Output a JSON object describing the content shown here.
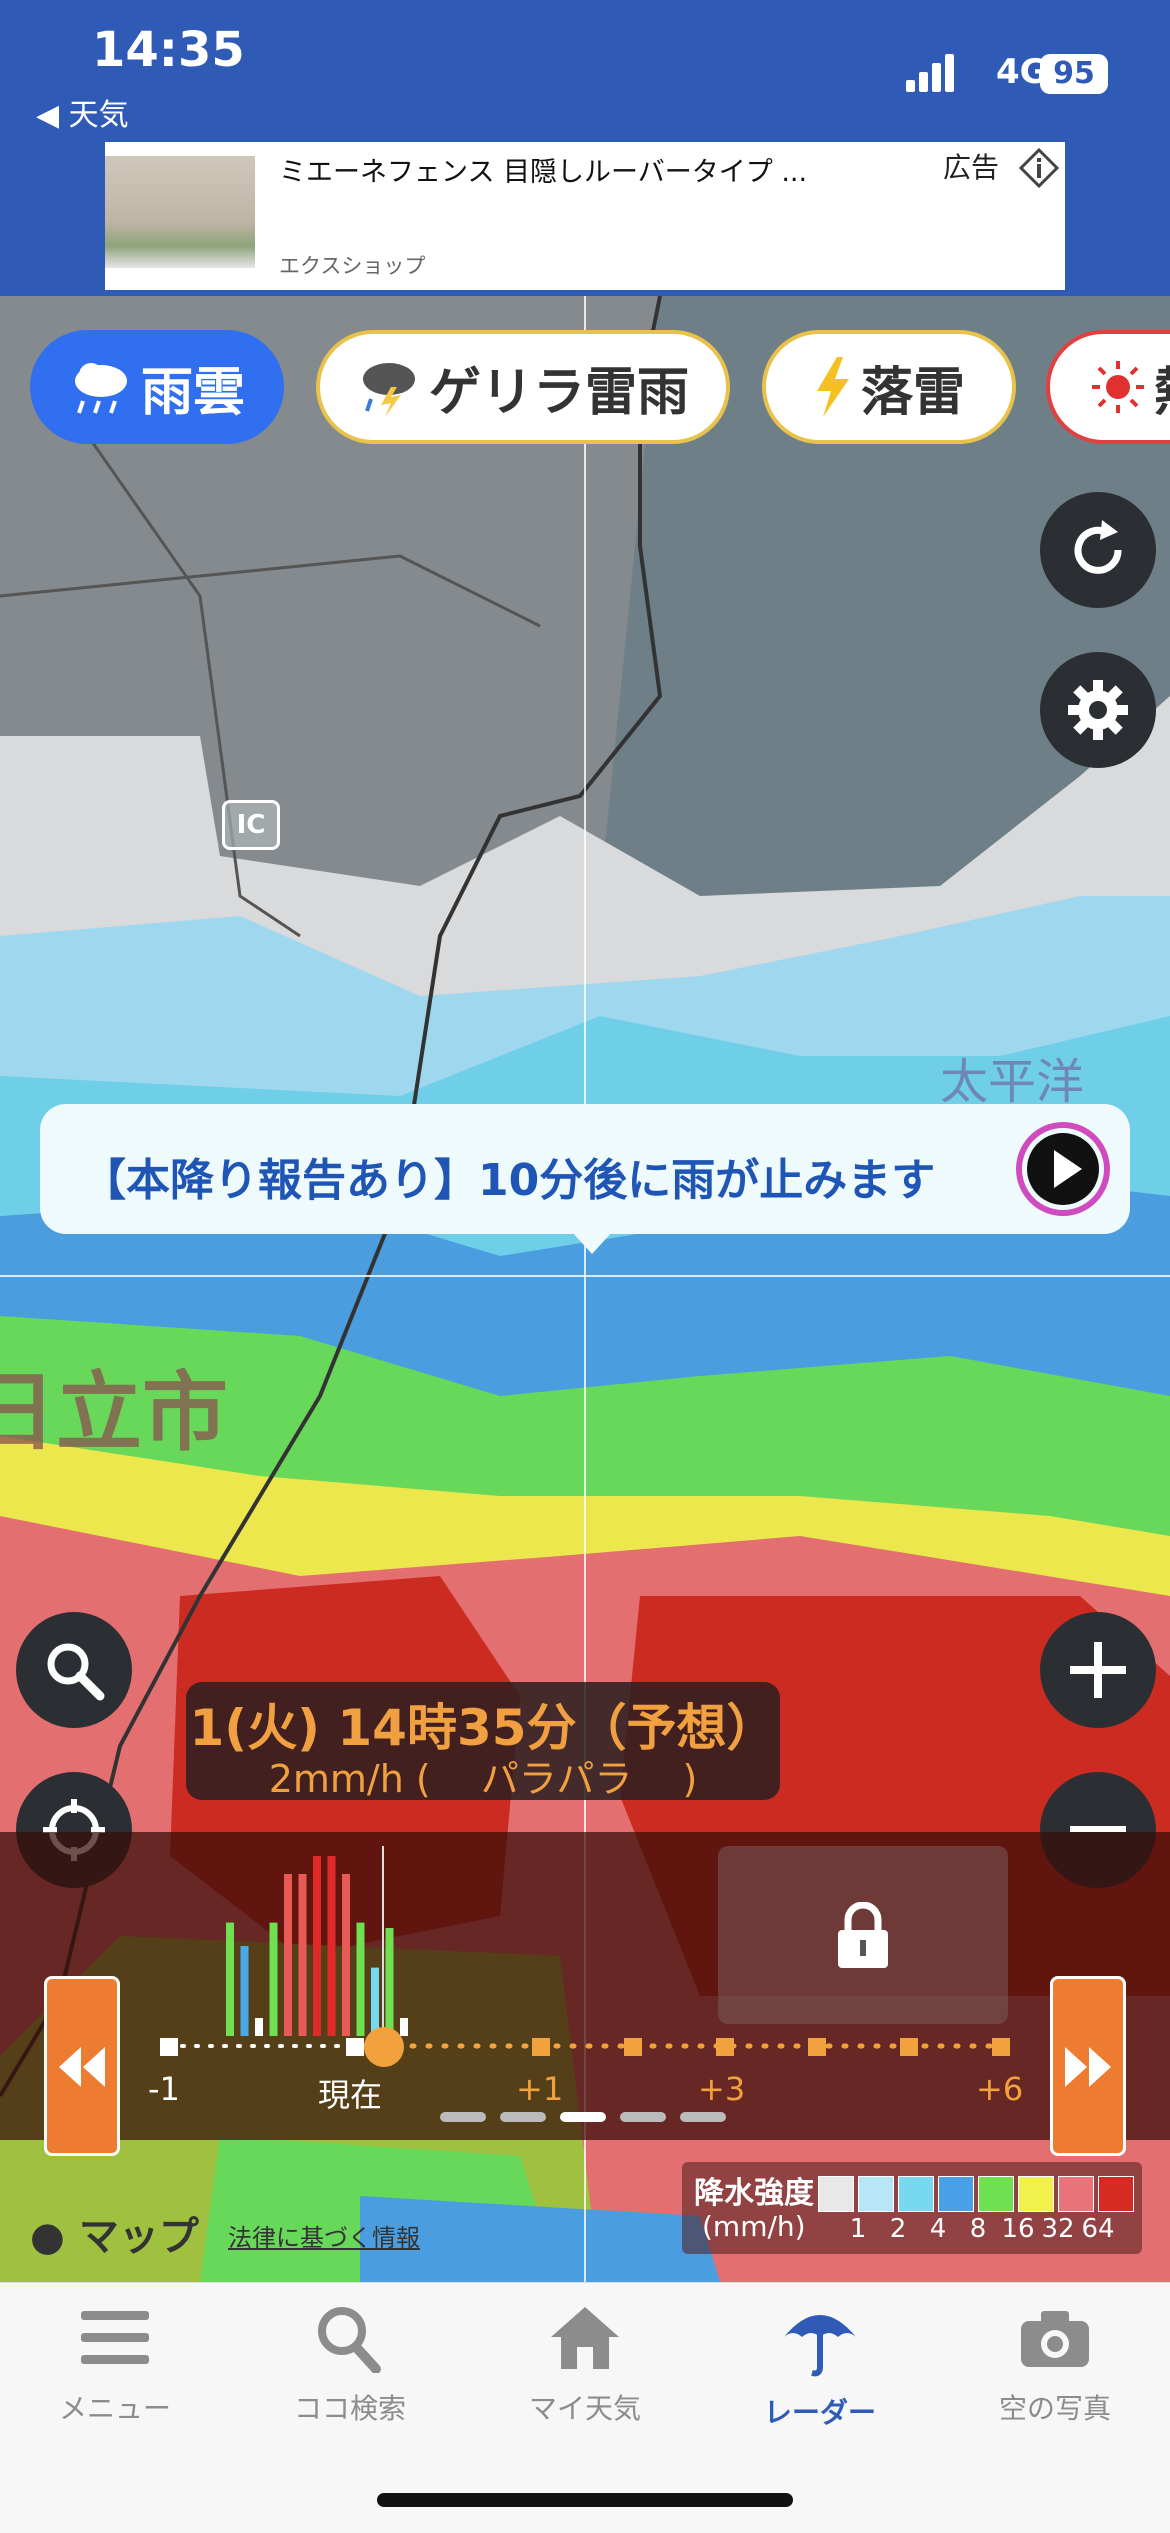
{
  "status_bar": {
    "time": "14:35",
    "back_label": "◀ 天気",
    "network": "4G",
    "battery": "95"
  },
  "ad": {
    "title": "ミエーネフェンス 目隠しルーバータイプ ...",
    "shop": "エクスショップ",
    "label": "広告"
  },
  "layer_tabs": [
    {
      "label": "雨雲",
      "icon": "rain-cloud-icon",
      "active": true
    },
    {
      "label": "ゲリラ雷雨",
      "icon": "thunder-cloud-icon",
      "active": false
    },
    {
      "label": "落雷",
      "icon": "lightning-icon",
      "active": false
    },
    {
      "label": "熱",
      "icon": "sun-icon",
      "active": false
    }
  ],
  "map": {
    "ic_label": "IC",
    "city_label": "日立市",
    "ocean_label": "太平洋"
  },
  "notice": {
    "text": "【本降り報告あり】10分後に雨が止みます"
  },
  "time_info": {
    "datetime": "1(火) 14時35分（予想）",
    "rate": "2mm/h (　 パラパラ　 )"
  },
  "timeline": {
    "labels": [
      "-1",
      "現在",
      "+1",
      "+3",
      "+6"
    ],
    "bars": [
      {
        "h": 0.63,
        "c": "#6fe050"
      },
      {
        "h": 0.5,
        "c": "#4aa8e8"
      },
      {
        "h": 0.1,
        "c": "#ffffff"
      },
      {
        "h": 0.63,
        "c": "#6fe050"
      },
      {
        "h": 0.9,
        "c": "#e85a55"
      },
      {
        "h": 0.9,
        "c": "#e85a55"
      },
      {
        "h": 1.0,
        "c": "#e02a2a"
      },
      {
        "h": 1.0,
        "c": "#e02a2a"
      },
      {
        "h": 0.9,
        "c": "#e85a55"
      },
      {
        "h": 0.63,
        "c": "#6fe050"
      },
      {
        "h": 0.38,
        "c": "#78d8f0"
      },
      {
        "h": 0.6,
        "c": "#6fe050"
      },
      {
        "h": 0.1,
        "c": "#ffffff"
      }
    ]
  },
  "legend": {
    "title": "降水強度",
    "unit": "(mm/h)",
    "colors": [
      "#e8e8e8",
      "#b7e6f7",
      "#78d8f0",
      "#4aa0e6",
      "#6fe050",
      "#f2f04a",
      "#e8737a",
      "#d62a22"
    ],
    "values": [
      "1",
      "2",
      "4",
      "8",
      "16",
      "32",
      "64"
    ]
  },
  "map_footer": {
    "apple_maps": "マップ",
    "legal": "法律に基づく情報"
  },
  "tab_bar": [
    {
      "label": "メニュー",
      "icon": "menu-icon",
      "active": false
    },
    {
      "label": "ココ検索",
      "icon": "search-icon",
      "active": false
    },
    {
      "label": "マイ天気",
      "icon": "home-icon",
      "active": false
    },
    {
      "label": "レーダー",
      "icon": "umbrella-icon",
      "active": true
    },
    {
      "label": "空の写真",
      "icon": "camera-icon",
      "active": false
    }
  ]
}
